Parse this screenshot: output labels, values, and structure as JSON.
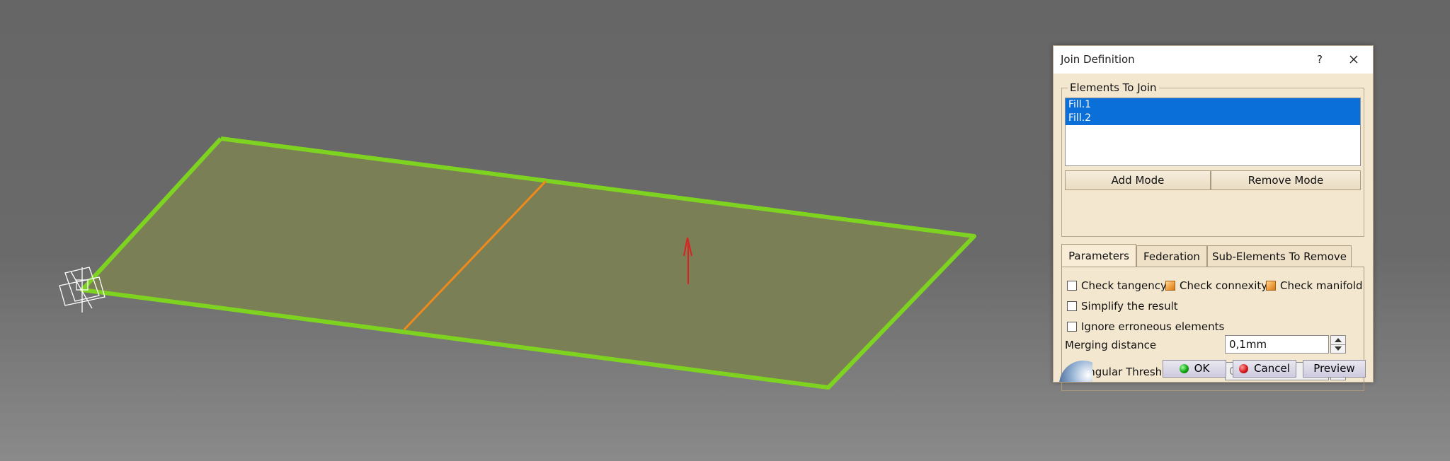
{
  "dialog": {
    "title": "Join Definition",
    "help_label": "?",
    "elements_group": {
      "legend": "Elements To Join",
      "items": [
        "Fill.1",
        "Fill.2"
      ],
      "add_mode_label": "Add Mode",
      "remove_mode_label": "Remove Mode"
    },
    "tabs": [
      {
        "label": "Parameters",
        "active": true
      },
      {
        "label": "Federation",
        "active": false
      },
      {
        "label": "Sub-Elements To Remove",
        "active": false
      }
    ],
    "parameters": {
      "check_tangency": {
        "label": "Check tangency",
        "checked": false
      },
      "check_connexity": {
        "label": "Check connexity",
        "checked": true
      },
      "check_manifold": {
        "label": "Check manifold",
        "checked": true
      },
      "simplify": {
        "label": "Simplify the result",
        "checked": false
      },
      "ignore_erroneous": {
        "label": "Ignore erroneous elements",
        "checked": false
      },
      "merging_distance": {
        "label": "Merging distance",
        "value": "0,1mm"
      },
      "angular_threshold": {
        "label": "Angular Threshold",
        "checked": false,
        "value": "0,5deg"
      }
    },
    "buttons": {
      "ok_label": "OK",
      "cancel_label": "Cancel",
      "preview_label": "Preview"
    }
  },
  "colors": {
    "surface_fill": "#7a8056",
    "surface_edge": "#7ed321",
    "split_line": "#f08a1a",
    "normal_arrow": "#dd2020",
    "selection": "#0a6fd8"
  }
}
